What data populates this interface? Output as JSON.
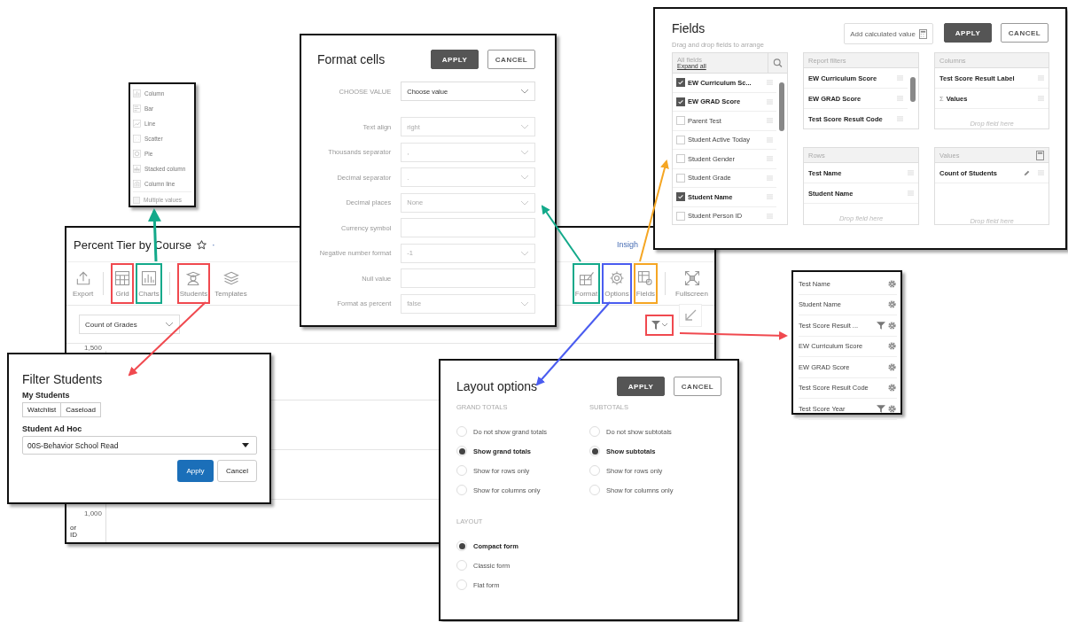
{
  "chart_type_menu": {
    "items": [
      {
        "label": "Column"
      },
      {
        "label": "Bar"
      },
      {
        "label": "Line"
      },
      {
        "label": "Scatter"
      },
      {
        "label": "Pie"
      },
      {
        "label": "Stacked column"
      },
      {
        "label": "Column line"
      }
    ],
    "multiple_values": {
      "label": "Multiple values",
      "checked": false,
      "disabled": true
    }
  },
  "report_window": {
    "title": "Percent Tier by Course",
    "title_suffix": "·",
    "header_link": "Insigh",
    "toolbar_left": [
      [
        {
          "label": "Export"
        }
      ],
      [
        {
          "label": "Grid",
          "color": "#f0494f"
        },
        {
          "label": "Charts",
          "color": "#13a98a"
        }
      ],
      [
        {
          "label": "Students",
          "color": "#f0494f"
        },
        {
          "label": "Templates"
        }
      ]
    ],
    "toolbar_right": [
      [
        {
          "label": "Format",
          "color": "#13a98a"
        },
        {
          "label": "Options",
          "color": "#4a5cf0"
        },
        {
          "label": "Fields",
          "color": "#f5a623"
        }
      ],
      [
        {
          "label": "Fullscreen"
        }
      ]
    ],
    "measure_select": {
      "value": "Count of Grades"
    },
    "filter_button": {
      "color": "#f0494f"
    },
    "y_ticks": [
      "1,500",
      "1,000"
    ],
    "y_axis_title": "orID"
  },
  "format_cells": {
    "title": "Format cells",
    "apply": "APPLY",
    "cancel": "CANCEL",
    "choose_value": {
      "label": "CHOOSE VALUE",
      "value": "Choose value"
    },
    "rows": [
      {
        "label": "Text align",
        "value": "right",
        "kind": "select"
      },
      {
        "label": "Thousands separator",
        "value": ",",
        "kind": "select"
      },
      {
        "label": "Decimal separator",
        "value": ".",
        "kind": "select"
      },
      {
        "label": "Decimal places",
        "value": "None",
        "kind": "select"
      },
      {
        "label": "Currency symbol",
        "kind": "input"
      },
      {
        "label": "Negative number format",
        "value": "-1",
        "kind": "select"
      },
      {
        "label": "Null value",
        "kind": "input"
      },
      {
        "label": "Format as percent",
        "value": "false",
        "kind": "select"
      }
    ]
  },
  "fields": {
    "title": "Fields",
    "add_calculated": "Add calculated value",
    "apply": "APPLY",
    "cancel": "CANCEL",
    "hint": "Drag and drop fields to arrange",
    "all_fields": {
      "title": "All fields",
      "expand": "Expand all",
      "items": [
        {
          "label": "EW Curriculum Sc...",
          "checked": true
        },
        {
          "label": "EW GRAD Score",
          "checked": true
        },
        {
          "label": "Parent Test",
          "checked": false
        },
        {
          "label": "Student Active Today",
          "checked": false
        },
        {
          "label": "Student Gender",
          "checked": false
        },
        {
          "label": "Student Grade",
          "checked": false
        },
        {
          "label": "Student Name",
          "checked": true
        },
        {
          "label": "Student Person ID",
          "checked": false
        }
      ]
    },
    "report_filters": {
      "title": "Report filters",
      "items": [
        {
          "label": "EW Curriculum Score"
        },
        {
          "label": "EW GRAD Score"
        },
        {
          "label": "Test Score Result Code"
        }
      ]
    },
    "columns": {
      "title": "Columns",
      "items": [
        {
          "label": "Test Score Result Label"
        },
        {
          "label": "Values",
          "prefix": "Σ"
        }
      ],
      "placeholder": "Drop field here"
    },
    "rows": {
      "title": "Rows",
      "items": [
        {
          "label": "Test Name"
        },
        {
          "label": "Student Name"
        }
      ],
      "placeholder": "Drop field here"
    },
    "values": {
      "title": "Values",
      "items": [
        {
          "label": "Count of Students",
          "kind": "measure"
        }
      ],
      "placeholder": "Drop field here"
    }
  },
  "layout_options": {
    "title": "Layout options",
    "apply": "APPLY",
    "cancel": "CANCEL",
    "groups": [
      {
        "title": "GRAND TOTALS",
        "options": [
          {
            "label": "Do not show grand totals",
            "selected": false
          },
          {
            "label": "Show grand totals",
            "selected": true
          },
          {
            "label": "Show for rows only",
            "selected": false
          },
          {
            "label": "Show for columns only",
            "selected": false
          }
        ]
      },
      {
        "title": "SUBTOTALS",
        "options": [
          {
            "label": "Do not show subtotals",
            "selected": false
          },
          {
            "label": "Show subtotals",
            "selected": true
          },
          {
            "label": "Show for rows only",
            "selected": false
          },
          {
            "label": "Show for columns only",
            "selected": false
          }
        ]
      },
      {
        "title": "LAYOUT",
        "options": [
          {
            "label": "Compact form",
            "selected": true
          },
          {
            "label": "Classic form",
            "selected": false
          },
          {
            "label": "Flat form",
            "selected": false
          }
        ]
      }
    ]
  },
  "filter_students": {
    "title": "Filter Students",
    "my_students": "My Students",
    "toggles": [
      "Watchlist",
      "Caseload"
    ],
    "ad_hoc_label": "Student Ad Hoc",
    "ad_hoc_value": "00S-Behavior School Read",
    "apply": "Apply",
    "cancel": "Cancel"
  },
  "filter_list": {
    "items": [
      {
        "label": "Test Name",
        "filtered": false
      },
      {
        "label": "Student Name",
        "filtered": false
      },
      {
        "label": "Test Score Result ...",
        "filtered": true
      },
      {
        "label": "EW Curriculum Score",
        "filtered": false
      },
      {
        "label": "EW GRAD Score",
        "filtered": false
      },
      {
        "label": "Test Score Result Code",
        "filtered": false
      },
      {
        "label": "Test Score Year",
        "filtered": true
      }
    ]
  }
}
